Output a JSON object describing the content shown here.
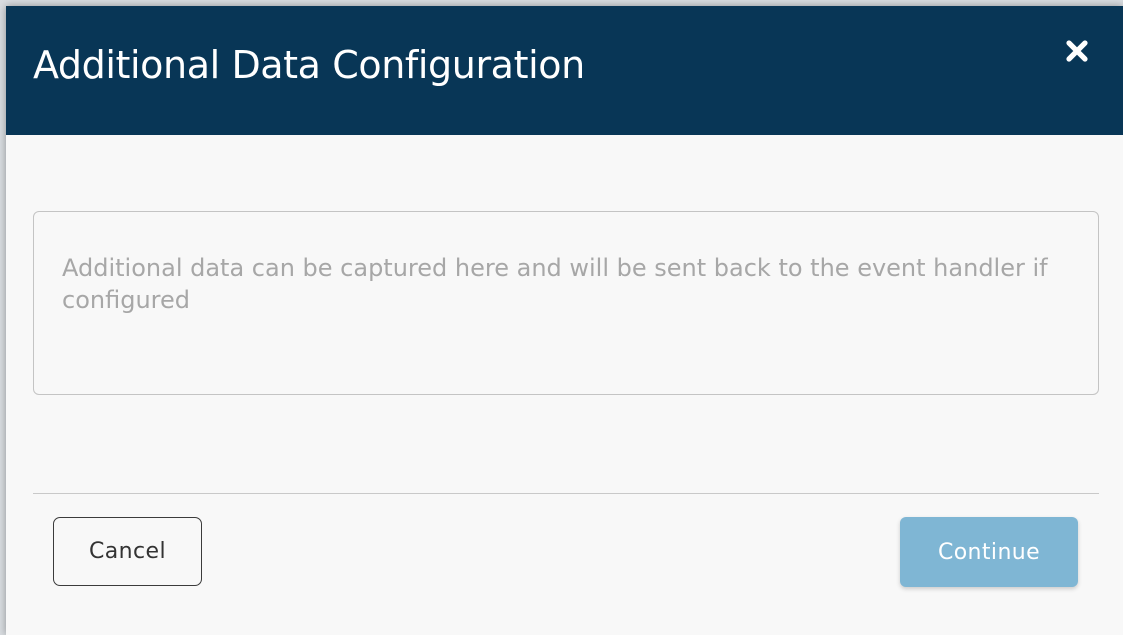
{
  "dialog": {
    "title": "Additional Data Configuration",
    "close_icon": "close-x-icon",
    "header_color": "#083656"
  },
  "additional_data": {
    "value": "",
    "placeholder": "Additional data can be captured here and will be sent back to the event handler if configured"
  },
  "footer": {
    "cancel_label": "Cancel",
    "continue_label": "Continue",
    "continue_color": "#7fb6d4"
  }
}
